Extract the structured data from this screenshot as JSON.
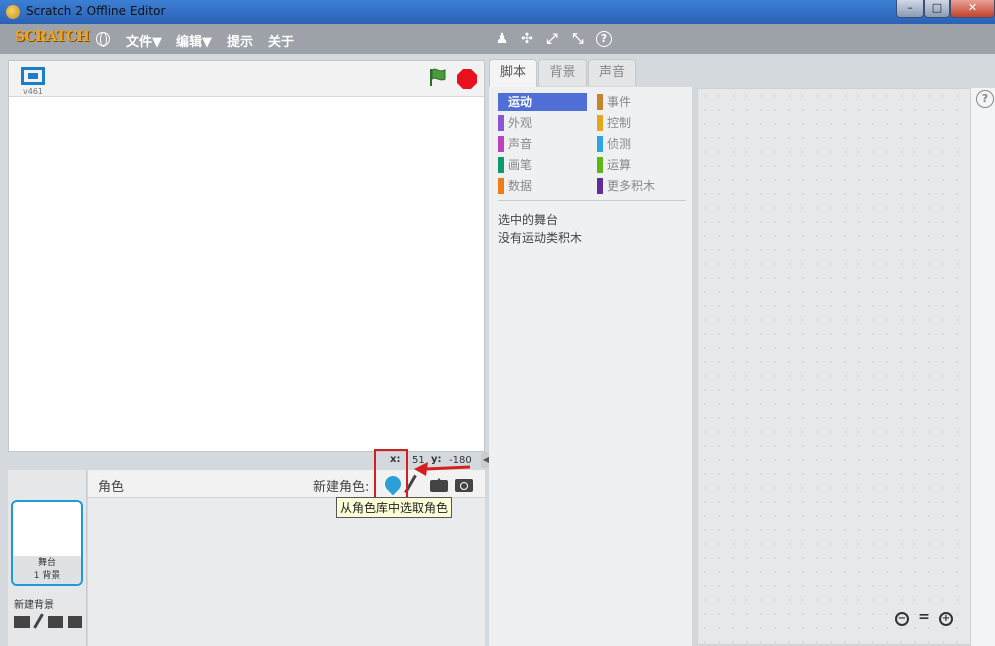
{
  "window": {
    "title": "Scratch 2 Offline Editor",
    "min": "–",
    "max": "□",
    "close": "✕"
  },
  "menubar": {
    "logo": "SCRATCH",
    "items": [
      "文件▼",
      "编辑▼",
      "提示",
      "关于"
    ],
    "tools": [
      "duplicate-icon",
      "cut-icon",
      "grow-icon",
      "shrink-icon",
      "help-icon"
    ],
    "tool_glyphs": [
      "♟",
      "✣",
      "⤢",
      "⤡",
      "?"
    ]
  },
  "stage": {
    "version": "v461"
  },
  "coords": {
    "x_label": "x:",
    "x_value": "51",
    "y_label": "y:",
    "y_value": "-180"
  },
  "sprites": {
    "title": "角色",
    "new_sprite": "新建角色:",
    "tooltip": "从角色库中选取角色",
    "stage_name": "舞台",
    "stage_backdrops": "1 背景",
    "new_backdrop": "新建背景"
  },
  "tabs": [
    "脚本",
    "背景",
    "声音"
  ],
  "categories": [
    {
      "label": "运动",
      "color": "#4a6cd4"
    },
    {
      "label": "事件",
      "color": "#c88330"
    },
    {
      "label": "外观",
      "color": "#8a55d7"
    },
    {
      "label": "控制",
      "color": "#e1a91a"
    },
    {
      "label": "声音",
      "color": "#bb42c3"
    },
    {
      "label": "侦测",
      "color": "#2ca5e2"
    },
    {
      "label": "画笔",
      "color": "#0e9a6c"
    },
    {
      "label": "运算",
      "color": "#5cb712"
    },
    {
      "label": "数据",
      "color": "#ee7d16"
    },
    {
      "label": "更多积木",
      "color": "#632d99"
    }
  ],
  "palette_notes": [
    "选中的舞台",
    "没有运动类积木"
  ],
  "script_area": {
    "help": "?",
    "zoom_out": "−",
    "zoom_reset": "=",
    "zoom_in": "+"
  }
}
